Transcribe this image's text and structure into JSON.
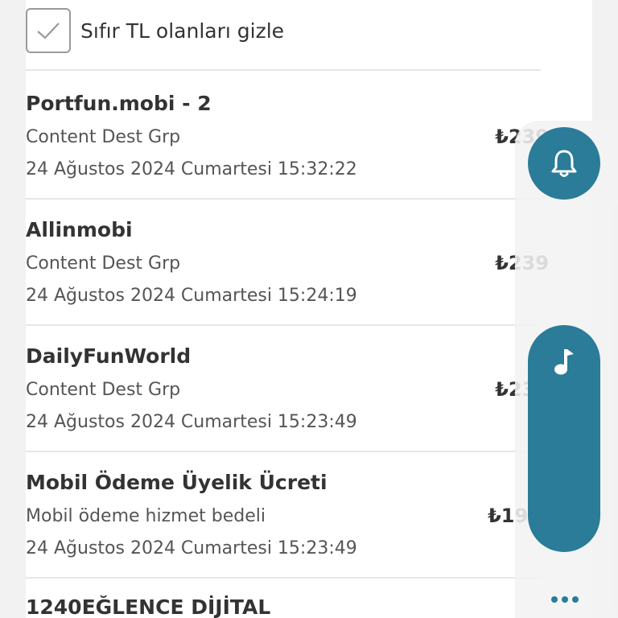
{
  "filter": {
    "hide_zero_label": "Sıfır TL olanları gizle",
    "checked": true
  },
  "transactions": [
    {
      "title": "Portfun.mobi - 2",
      "subtitle": "Content Dest Grp",
      "date": "24 Ağustos 2024 Cumartesi 15:32:22",
      "amount": "₺239"
    },
    {
      "title": "Allinmobi",
      "subtitle": "Content Dest Grp",
      "date": "24 Ağustos 2024 Cumartesi 15:24:19",
      "amount": "₺239"
    },
    {
      "title": "DailyFunWorld",
      "subtitle": "Content Dest Grp",
      "date": "24 Ağustos 2024 Cumartesi 15:23:49",
      "amount": "₺239"
    },
    {
      "title": "Mobil Ödeme Üyelik Ücreti",
      "subtitle": "Mobil ödeme hizmet bedeli",
      "date": "24 Ağustos 2024 Cumartesi 15:23:49",
      "amount": "₺19,9"
    },
    {
      "title": "1240EĞLENCE DİJİTAL"
    }
  ],
  "icons": {
    "checkbox": "check-icon",
    "notifications": "bell-icon",
    "music": "music-note-icon",
    "more": "more-dots-icon"
  },
  "colors": {
    "accent": "#2a7c98",
    "background": "#f2f2f2",
    "card": "#ffffff",
    "text": "#333333"
  }
}
